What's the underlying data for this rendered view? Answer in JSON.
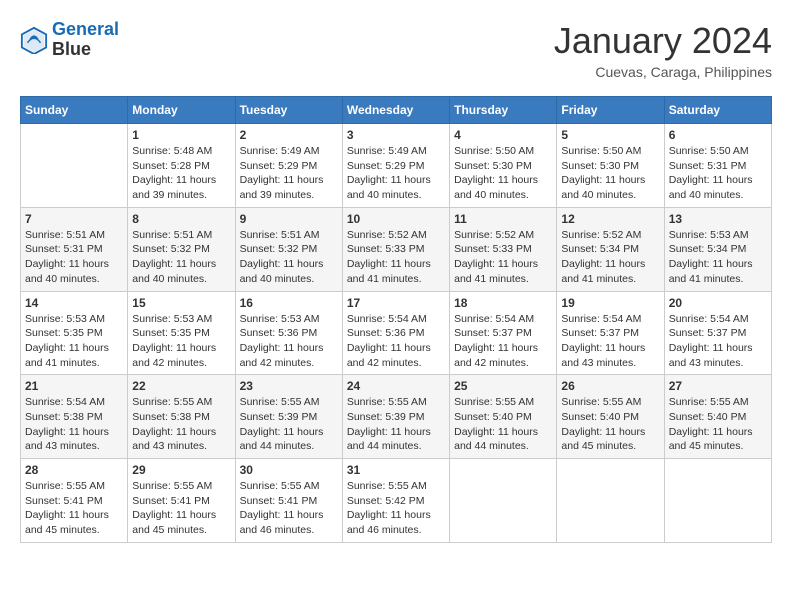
{
  "header": {
    "logo_line1": "General",
    "logo_line2": "Blue",
    "title": "January 2024",
    "location": "Cuevas, Caraga, Philippines"
  },
  "columns": [
    "Sunday",
    "Monday",
    "Tuesday",
    "Wednesday",
    "Thursday",
    "Friday",
    "Saturday"
  ],
  "weeks": [
    [
      {
        "num": "",
        "info": ""
      },
      {
        "num": "1",
        "info": "Sunrise: 5:48 AM\nSunset: 5:28 PM\nDaylight: 11 hours\nand 39 minutes."
      },
      {
        "num": "2",
        "info": "Sunrise: 5:49 AM\nSunset: 5:29 PM\nDaylight: 11 hours\nand 39 minutes."
      },
      {
        "num": "3",
        "info": "Sunrise: 5:49 AM\nSunset: 5:29 PM\nDaylight: 11 hours\nand 40 minutes."
      },
      {
        "num": "4",
        "info": "Sunrise: 5:50 AM\nSunset: 5:30 PM\nDaylight: 11 hours\nand 40 minutes."
      },
      {
        "num": "5",
        "info": "Sunrise: 5:50 AM\nSunset: 5:30 PM\nDaylight: 11 hours\nand 40 minutes."
      },
      {
        "num": "6",
        "info": "Sunrise: 5:50 AM\nSunset: 5:31 PM\nDaylight: 11 hours\nand 40 minutes."
      }
    ],
    [
      {
        "num": "7",
        "info": "Sunrise: 5:51 AM\nSunset: 5:31 PM\nDaylight: 11 hours\nand 40 minutes."
      },
      {
        "num": "8",
        "info": "Sunrise: 5:51 AM\nSunset: 5:32 PM\nDaylight: 11 hours\nand 40 minutes."
      },
      {
        "num": "9",
        "info": "Sunrise: 5:51 AM\nSunset: 5:32 PM\nDaylight: 11 hours\nand 40 minutes."
      },
      {
        "num": "10",
        "info": "Sunrise: 5:52 AM\nSunset: 5:33 PM\nDaylight: 11 hours\nand 41 minutes."
      },
      {
        "num": "11",
        "info": "Sunrise: 5:52 AM\nSunset: 5:33 PM\nDaylight: 11 hours\nand 41 minutes."
      },
      {
        "num": "12",
        "info": "Sunrise: 5:52 AM\nSunset: 5:34 PM\nDaylight: 11 hours\nand 41 minutes."
      },
      {
        "num": "13",
        "info": "Sunrise: 5:53 AM\nSunset: 5:34 PM\nDaylight: 11 hours\nand 41 minutes."
      }
    ],
    [
      {
        "num": "14",
        "info": "Sunrise: 5:53 AM\nSunset: 5:35 PM\nDaylight: 11 hours\nand 41 minutes."
      },
      {
        "num": "15",
        "info": "Sunrise: 5:53 AM\nSunset: 5:35 PM\nDaylight: 11 hours\nand 42 minutes."
      },
      {
        "num": "16",
        "info": "Sunrise: 5:53 AM\nSunset: 5:36 PM\nDaylight: 11 hours\nand 42 minutes."
      },
      {
        "num": "17",
        "info": "Sunrise: 5:54 AM\nSunset: 5:36 PM\nDaylight: 11 hours\nand 42 minutes."
      },
      {
        "num": "18",
        "info": "Sunrise: 5:54 AM\nSunset: 5:37 PM\nDaylight: 11 hours\nand 42 minutes."
      },
      {
        "num": "19",
        "info": "Sunrise: 5:54 AM\nSunset: 5:37 PM\nDaylight: 11 hours\nand 43 minutes."
      },
      {
        "num": "20",
        "info": "Sunrise: 5:54 AM\nSunset: 5:37 PM\nDaylight: 11 hours\nand 43 minutes."
      }
    ],
    [
      {
        "num": "21",
        "info": "Sunrise: 5:54 AM\nSunset: 5:38 PM\nDaylight: 11 hours\nand 43 minutes."
      },
      {
        "num": "22",
        "info": "Sunrise: 5:55 AM\nSunset: 5:38 PM\nDaylight: 11 hours\nand 43 minutes."
      },
      {
        "num": "23",
        "info": "Sunrise: 5:55 AM\nSunset: 5:39 PM\nDaylight: 11 hours\nand 44 minutes."
      },
      {
        "num": "24",
        "info": "Sunrise: 5:55 AM\nSunset: 5:39 PM\nDaylight: 11 hours\nand 44 minutes."
      },
      {
        "num": "25",
        "info": "Sunrise: 5:55 AM\nSunset: 5:40 PM\nDaylight: 11 hours\nand 44 minutes."
      },
      {
        "num": "26",
        "info": "Sunrise: 5:55 AM\nSunset: 5:40 PM\nDaylight: 11 hours\nand 45 minutes."
      },
      {
        "num": "27",
        "info": "Sunrise: 5:55 AM\nSunset: 5:40 PM\nDaylight: 11 hours\nand 45 minutes."
      }
    ],
    [
      {
        "num": "28",
        "info": "Sunrise: 5:55 AM\nSunset: 5:41 PM\nDaylight: 11 hours\nand 45 minutes."
      },
      {
        "num": "29",
        "info": "Sunrise: 5:55 AM\nSunset: 5:41 PM\nDaylight: 11 hours\nand 45 minutes."
      },
      {
        "num": "30",
        "info": "Sunrise: 5:55 AM\nSunset: 5:41 PM\nDaylight: 11 hours\nand 46 minutes."
      },
      {
        "num": "31",
        "info": "Sunrise: 5:55 AM\nSunset: 5:42 PM\nDaylight: 11 hours\nand 46 minutes."
      },
      {
        "num": "",
        "info": ""
      },
      {
        "num": "",
        "info": ""
      },
      {
        "num": "",
        "info": ""
      }
    ]
  ]
}
